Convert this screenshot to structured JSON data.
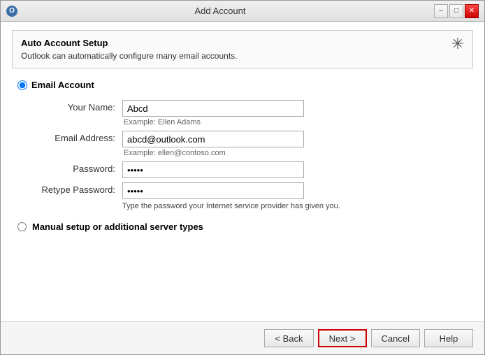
{
  "window": {
    "title": "Add Account",
    "icon": "O"
  },
  "titlebar": {
    "minimize_label": "–",
    "maximize_label": "□",
    "close_label": "✕"
  },
  "auto_setup": {
    "heading": "Auto Account Setup",
    "description": "Outlook can automatically configure many email accounts."
  },
  "form": {
    "email_account_label": "Email Account",
    "your_name_label": "Your Name:",
    "your_name_value": "Abcd",
    "your_name_example": "Example: Ellen Adams",
    "email_address_label": "Email Address:",
    "email_address_value": "abcd@outlook.com",
    "email_address_example": "Example: ellen@contoso.com",
    "password_label": "Password:",
    "password_value": "*****",
    "retype_password_label": "Retype Password:",
    "retype_password_value": "*****",
    "password_hint": "Type the password your Internet service provider has given you.",
    "manual_setup_label": "Manual setup or additional server types"
  },
  "footer": {
    "back_label": "< Back",
    "next_label": "Next >",
    "cancel_label": "Cancel",
    "help_label": "Help"
  }
}
